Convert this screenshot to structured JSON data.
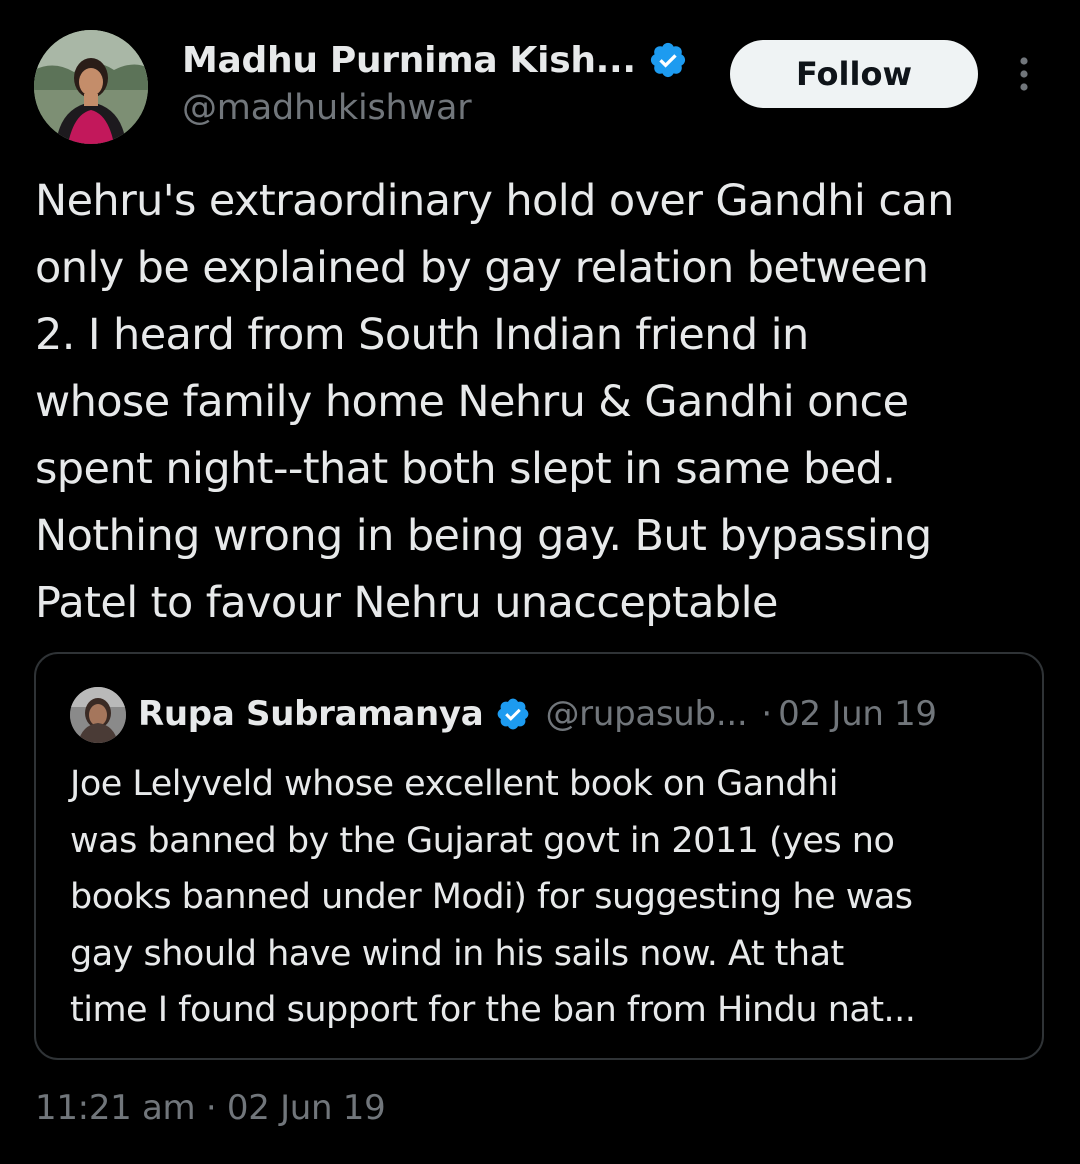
{
  "author": {
    "name": "Madhu Purnima Kish...",
    "handle": "@madhukishwar",
    "verified": true,
    "avatar_icon": "profile-photo"
  },
  "actions": {
    "follow_label": "Follow",
    "more_icon": "more-vertical-icon"
  },
  "tweet": {
    "lines": [
      "Nehru's extraordinary hold over Gandhi can",
      "only be explained by gay relation between",
      "2. I heard from South Indian friend in",
      "whose family home Nehru & Gandhi once",
      "spent night--that both slept in same bed.",
      "Nothing wrong in being gay. But bypassing",
      "Patel to favour Nehru unacceptable"
    ]
  },
  "quoted_tweet": {
    "name": "Rupa Subramanya",
    "handle": "@rupasub...",
    "separator": "·",
    "date": "02 Jun 19",
    "verified": true,
    "lines": [
      "Joe Lelyveld whose excellent book on Gandhi",
      "was banned by the Gujarat govt in 2011 (yes no",
      "books banned under Modi) for suggesting he was",
      "gay should have wind in his sails now. At that",
      "time I found support for the ban from Hindu nat..."
    ]
  },
  "meta": {
    "time": "11:21 am",
    "separator": "·",
    "date": "02 Jun 19"
  },
  "colors": {
    "background": "#000000",
    "text_primary": "#e7e9ea",
    "text_secondary": "#71767b",
    "verified_blue": "#1d9bf0",
    "border": "#2f3336",
    "follow_bg": "#eff3f4"
  }
}
